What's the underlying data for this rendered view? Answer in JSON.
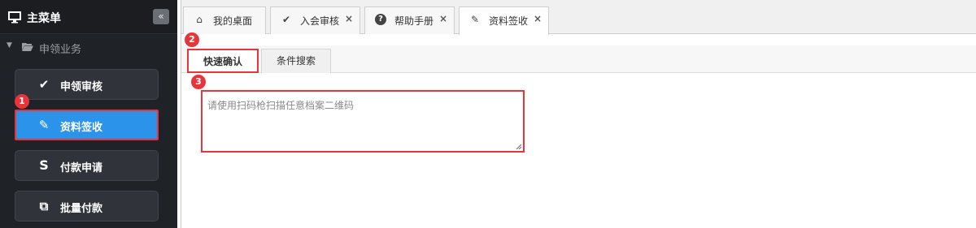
{
  "sidebar": {
    "title": "主菜单",
    "collapse_glyph": "«",
    "group": {
      "label": "申领业务",
      "caret": "▼"
    },
    "items": [
      {
        "label": "申领审核",
        "icon": "check-icon",
        "glyph": "✔"
      },
      {
        "label": "资料签收",
        "icon": "pencil-icon",
        "glyph": "✎"
      },
      {
        "label": "付款申请",
        "icon": "dollar-s-icon",
        "glyph": "S"
      },
      {
        "label": "批量付款",
        "icon": "copy-icon",
        "glyph": "⧉"
      }
    ]
  },
  "tabs": [
    {
      "label": "我的桌面",
      "icon": "home-icon",
      "glyph": "⌂"
    },
    {
      "label": "入会审核",
      "icon": "check-icon",
      "glyph": "✔",
      "close": "×"
    },
    {
      "label": "帮助手册",
      "icon": "question-circle-icon",
      "glyph": "?",
      "close": "×"
    },
    {
      "label": "资料签收",
      "icon": "pencil-icon",
      "glyph": "✎",
      "close": "×"
    }
  ],
  "subtabs": [
    {
      "label": "快速确认"
    },
    {
      "label": "条件搜索"
    }
  ],
  "scan_input": {
    "placeholder": "请使用扫码枪扫描任意档案二维码",
    "value": ""
  },
  "badges": [
    "1",
    "2",
    "3"
  ],
  "colors": {
    "highlight": "#e8353b",
    "active_menu": "#2b94ea",
    "sidebar_bg": "#1f2226"
  }
}
